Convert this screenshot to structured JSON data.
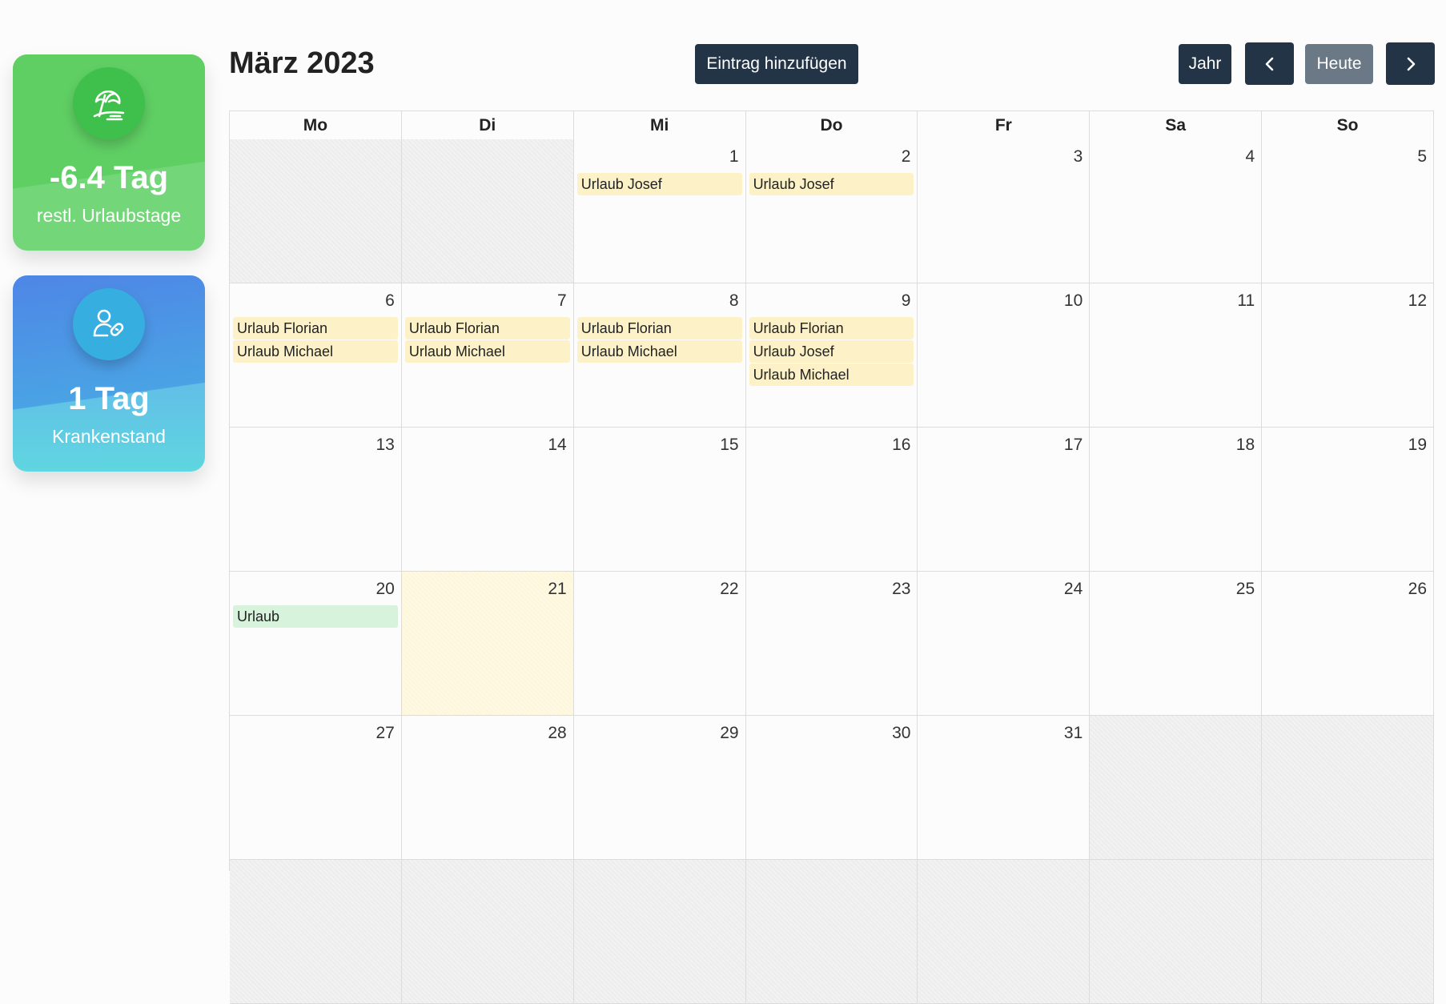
{
  "sidebar": {
    "vacation_card": {
      "icon": "beach-umbrella-icon",
      "value": "-6.4 Tag",
      "label": "restl. Urlaubstage"
    },
    "sick_card": {
      "icon": "user-bandage-icon",
      "value": "1 Tag",
      "label": "Krankenstand"
    }
  },
  "header": {
    "title": "März 2023",
    "add_entry_label": "Eintrag hinzufügen",
    "year_label": "Jahr",
    "prev_icon": "chevron-left-icon",
    "today_label": "Heute",
    "next_icon": "chevron-right-icon"
  },
  "calendar": {
    "weekdays": [
      "Mo",
      "Di",
      "Mi",
      "Do",
      "Fr",
      "Sa",
      "So"
    ],
    "weeks": [
      [
        {
          "num": "",
          "other": true,
          "events": []
        },
        {
          "num": "",
          "other": true,
          "events": []
        },
        {
          "num": "1",
          "events": [
            {
              "title": "Urlaub Josef"
            }
          ]
        },
        {
          "num": "2",
          "events": [
            {
              "title": "Urlaub Josef"
            }
          ]
        },
        {
          "num": "3",
          "events": []
        },
        {
          "num": "4",
          "events": []
        },
        {
          "num": "5",
          "events": []
        }
      ],
      [
        {
          "num": "6",
          "events": [
            {
              "title": "Urlaub Florian"
            },
            {
              "title": "Urlaub Michael"
            }
          ]
        },
        {
          "num": "7",
          "events": [
            {
              "title": "Urlaub Florian"
            },
            {
              "title": "Urlaub Michael"
            }
          ]
        },
        {
          "num": "8",
          "events": [
            {
              "title": "Urlaub Florian"
            },
            {
              "title": "Urlaub Michael"
            }
          ]
        },
        {
          "num": "9",
          "events": [
            {
              "title": "Urlaub Florian"
            },
            {
              "title": "Urlaub Josef"
            },
            {
              "title": "Urlaub Michael"
            }
          ]
        },
        {
          "num": "10",
          "events": []
        },
        {
          "num": "11",
          "events": []
        },
        {
          "num": "12",
          "events": []
        }
      ],
      [
        {
          "num": "13",
          "events": []
        },
        {
          "num": "14",
          "events": []
        },
        {
          "num": "15",
          "events": []
        },
        {
          "num": "16",
          "events": []
        },
        {
          "num": "17",
          "events": []
        },
        {
          "num": "18",
          "events": []
        },
        {
          "num": "19",
          "events": []
        }
      ],
      [
        {
          "num": "20",
          "events": [
            {
              "title": "Urlaub",
              "own": true
            }
          ]
        },
        {
          "num": "21",
          "today": true,
          "events": []
        },
        {
          "num": "22",
          "events": []
        },
        {
          "num": "23",
          "events": []
        },
        {
          "num": "24",
          "events": []
        },
        {
          "num": "25",
          "events": []
        },
        {
          "num": "26",
          "events": []
        }
      ],
      [
        {
          "num": "27",
          "events": []
        },
        {
          "num": "28",
          "events": []
        },
        {
          "num": "29",
          "events": []
        },
        {
          "num": "30",
          "events": []
        },
        {
          "num": "31",
          "events": []
        },
        {
          "num": "",
          "other": true,
          "events": []
        },
        {
          "num": "",
          "other": true,
          "events": []
        }
      ],
      [
        {
          "num": "",
          "other": true,
          "events": []
        },
        {
          "num": "",
          "other": true,
          "events": []
        },
        {
          "num": "",
          "other": true,
          "events": []
        },
        {
          "num": "",
          "other": true,
          "events": []
        },
        {
          "num": "",
          "other": true,
          "events": []
        },
        {
          "num": "",
          "other": true,
          "events": []
        },
        {
          "num": "",
          "other": true,
          "events": []
        }
      ]
    ]
  },
  "colors": {
    "vacation_card": "#5fcf63",
    "sick_card": "#4e86e6",
    "button_dark": "#243447",
    "button_today": "#6b7886",
    "event_team": "#fcf1c7",
    "event_own": "#d8f3dc",
    "today_cell": "#fdf6d8"
  }
}
